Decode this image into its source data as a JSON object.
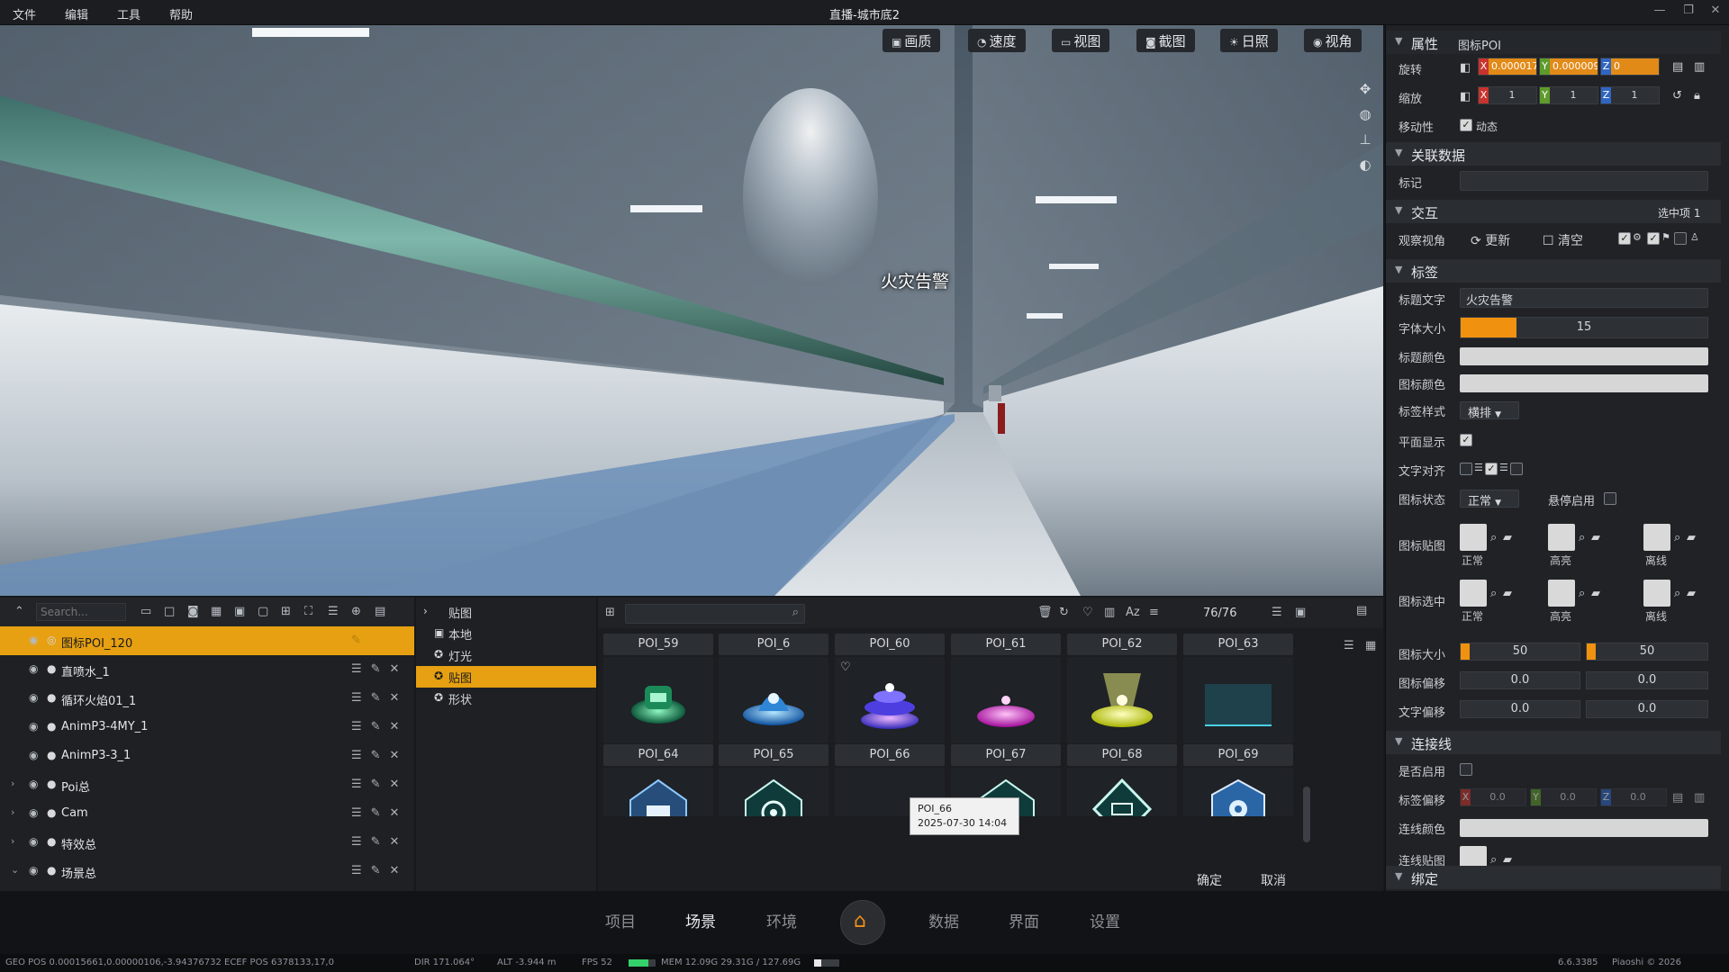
{
  "menu": [
    "文件",
    "编辑",
    "工具",
    "帮助"
  ],
  "window_title": "直播-城市底2",
  "viewport": {
    "toolbar": [
      {
        "icon": "image-icon",
        "glyph": "▣",
        "label": "画质"
      },
      {
        "icon": "speed-icon",
        "glyph": "◔",
        "label": "速度"
      },
      {
        "icon": "video-icon",
        "glyph": "▭",
        "label": "视图"
      },
      {
        "icon": "camera-icon",
        "glyph": "◙",
        "label": "截图"
      },
      {
        "icon": "sun-icon",
        "glyph": "☀",
        "label": "日照"
      },
      {
        "icon": "eye-icon",
        "glyph": "◉",
        "label": "视角"
      }
    ],
    "poi_label": "火灾告警"
  },
  "properties": {
    "header": {
      "title": "属性",
      "subtitle": "图标POI"
    },
    "rotation": {
      "label": "旋转",
      "x": "0.000017",
      "y": "0.000009",
      "z": "0"
    },
    "scale": {
      "label": "缩放",
      "x": "1",
      "y": "1",
      "z": "1"
    },
    "mobility": {
      "label": "移动性",
      "value": "动态"
    },
    "section_data": "关联数据",
    "tag": {
      "label": "标记",
      "value": ""
    },
    "section_interact": "交互",
    "selected_count": "选中项 1",
    "observe": {
      "label": "观察视角",
      "update": "更新",
      "clear": "清空"
    },
    "section_label": "标签",
    "title_text": {
      "label": "标题文字",
      "value": "火灾告警"
    },
    "font_size": {
      "label": "字体大小",
      "value": "15",
      "fill": 0.15
    },
    "title_color": {
      "label": "标题颜色",
      "color": "#d6d6d6"
    },
    "icon_color": {
      "label": "图标颜色",
      "color": "#d6d6d6"
    },
    "label_style": {
      "label": "标签样式",
      "value": "横排"
    },
    "flat_display": {
      "label": "平面显示"
    },
    "text_align": {
      "label": "文字对齐"
    },
    "icon_state": {
      "label": "图标状态",
      "value": "正常",
      "hover_label": "悬停启用"
    },
    "icon_texture": {
      "label": "图标贴图",
      "states": [
        "正常",
        "高亮",
        "离线"
      ]
    },
    "icon_selected": {
      "label": "图标选中",
      "states": [
        "正常",
        "高亮",
        "离线"
      ]
    },
    "icon_size": {
      "label": "图标大小",
      "w": "50",
      "h": "50"
    },
    "icon_offset": {
      "label": "图标偏移",
      "x": "0.0",
      "y": "0.0"
    },
    "text_offset": {
      "label": "文字偏移",
      "x": "0.0",
      "y": "0.0"
    },
    "section_connect": "连接线",
    "enabled": {
      "label": "是否启用"
    },
    "label_offset": {
      "label": "标签偏移",
      "x": "0.0",
      "y": "0.0",
      "z": "0.0"
    },
    "line_color": {
      "label": "连线颜色",
      "color": "#d6d6d6"
    },
    "line_texture": {
      "label": "连线贴图"
    },
    "section_bind": "绑定"
  },
  "scene_tree": {
    "search_placeholder": "Search...",
    "items": [
      {
        "name": "图标POI_120",
        "selected": true
      },
      {
        "name": "直喷水_1"
      },
      {
        "name": "循环火焰01_1"
      },
      {
        "name": "AnimP3-4MY_1"
      },
      {
        "name": "AnimP3-3_1"
      },
      {
        "name": "Poi总",
        "expand": "›"
      },
      {
        "name": "Cam",
        "expand": "›"
      },
      {
        "name": "特效总",
        "expand": "›"
      },
      {
        "name": "场景总",
        "expand": "⌄"
      }
    ]
  },
  "categories": [
    {
      "icon": "›",
      "label": "贴图"
    },
    {
      "icon": "▣",
      "label": "本地"
    },
    {
      "icon": "✪",
      "label": "灯光"
    },
    {
      "icon": "✪",
      "label": "贴图",
      "selected": true
    },
    {
      "icon": "✪",
      "label": "形状"
    }
  ],
  "assets": {
    "count": "76/76",
    "row1": [
      "POI_59",
      "POI_6",
      "POI_60",
      "POI_61",
      "POI_62",
      "POI_63"
    ],
    "row2": [
      "POI_64",
      "POI_65",
      "POI_66",
      "POI_67",
      "POI_68",
      "POI_69"
    ],
    "tooltip": {
      "name": "POI_66",
      "date": "2025-07-30 14:04"
    },
    "confirm": "确定",
    "cancel": "取消"
  },
  "bottom_nav": [
    "项目",
    "场景",
    "环境",
    "数据",
    "界面",
    "设置"
  ],
  "status": {
    "geo": "GEO POS  0.00015661,0.00000106,-3.94376732  ECEF POS  6378133,17,0",
    "dir": "DIR   171.064°",
    "alt": "ALT   -3.944 m",
    "fps": "FPS   52",
    "mem": "MEM   12.09G   29.31G / 127.69G",
    "ver": "6.6.3385",
    "copy": "Piaoshi © 2026"
  }
}
